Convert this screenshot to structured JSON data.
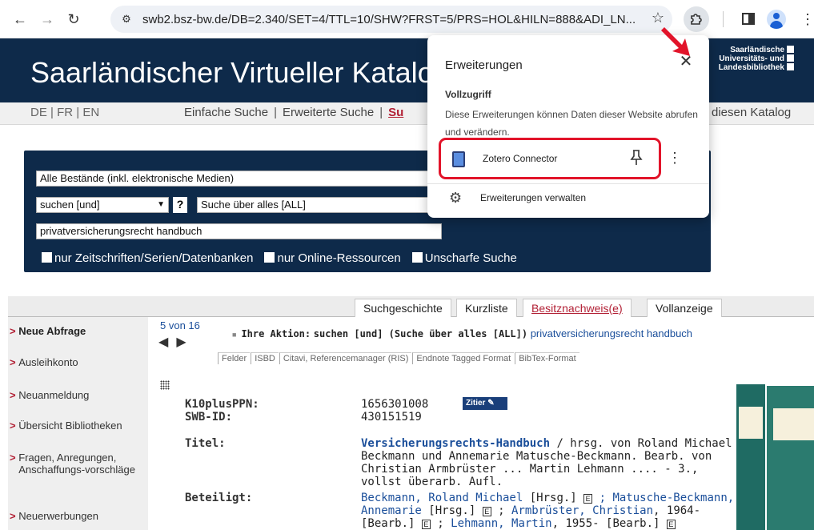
{
  "browser": {
    "url": "swb2.bsz-bw.de/DB=2.340/SET=4/TTL=10/SHW?FRST=5/PRS=HOL&HILN=888&ADI_LN...",
    "back_icon": "arrow-left-icon",
    "forward_icon": "arrow-right-icon",
    "reload_icon": "reload-icon",
    "star_icon": "star-icon",
    "extensions_icon": "puzzle-icon"
  },
  "site": {
    "title": "Saarländischer Virtueller Katalog",
    "logo_lines": [
      "Saarländische",
      "Universitäts- und",
      "Landesbibliothek"
    ],
    "languages": [
      "DE",
      "FR",
      "EN"
    ],
    "nav": [
      "Einfache Suche",
      "Erweiterte Suche",
      "Su"
    ],
    "nav_right": "diesen Katalog"
  },
  "search": {
    "scope": "Alle Bestände (inkl. elektronische Medien)",
    "operator": "suchen [und]",
    "help": "?",
    "field": "Suche über alles [ALL]",
    "query": "privatversicherungsrecht handbuch",
    "filters": [
      "nur Zeitschriften/Serien/Datenbanken",
      "nur Online-Ressourcen",
      "Unscharfe Suche"
    ]
  },
  "result_tabs": [
    {
      "label": "Suchgeschichte",
      "active": false
    },
    {
      "label": "Kurzliste",
      "active": false
    },
    {
      "label": "Besitznachweis(e)",
      "active": true
    },
    {
      "label": "Vollanzeige",
      "active": false
    }
  ],
  "sidebar": [
    {
      "label": "Neue Abfrage",
      "bold": true
    },
    {
      "label": "Ausleihkonto",
      "bold": false
    },
    {
      "label": "Neuanmeldung",
      "bold": false
    },
    {
      "label": "Übersicht Bibliotheken",
      "bold": false
    },
    {
      "label": "Fragen, Anregungen, Anschaffungs-vorschläge",
      "bold": false
    },
    {
      "label": "Neuerwerbungen",
      "bold": false
    }
  ],
  "result": {
    "counter": "5 von 16",
    "action_label": "Ihre Aktion:",
    "action_text": "suchen [und] (Suche über alles [ALL])",
    "action_query": "privatversicherungsrecht handbuch",
    "formats": [
      "Felder",
      "ISBD",
      "Citavi, Referencemanager (RIS)",
      "Endnote Tagged Format",
      "BibTex-Format"
    ],
    "cite_label": "Zitier",
    "fields": {
      "ppn_label": "K10plusPPN:",
      "ppn": "1656301008",
      "swb_label": "SWB-ID:",
      "swb": "430151519",
      "title_label": "Titel:",
      "title_main": "Versicherungsrechts-Handbuch",
      "title_rest": " / hrsg. von Roland Michael Beckmann und Annemarie Matusche-Beckmann. Bearb. von Christian Armbrüster ... Martin Lehmann .... - 3., vollst überarb. Aufl.",
      "contrib_label": "Beteiligt:",
      "contrib_1": "Beckmann, Roland Michael",
      "contrib_1_role": " [Hrsg.] ",
      "contrib_2": "Matusche-Beckmann, Annemarie",
      "contrib_2_role": " [Hrsg.] ",
      "contrib_3": "Armbrüster, Christian",
      "contrib_3_role": ", 1964- [Bearb.] ",
      "contrib_4": "Lehmann, Martin",
      "contrib_4_role": ", 1955- [Bearb.] "
    }
  },
  "extensions_popup": {
    "title": "Erweiterungen",
    "close_icon": "close-icon",
    "section": "Vollzugriff",
    "description": "Diese Erweiterungen können Daten dieser Website abrufen und verändern.",
    "extension_name": "Zotero Connector",
    "pin_icon": "pin-icon",
    "more_icon": "more-vert-icon",
    "manage_label": "Erweiterungen verwalten",
    "manage_icon": "gear-icon",
    "highlight_color": "#e2142a"
  }
}
